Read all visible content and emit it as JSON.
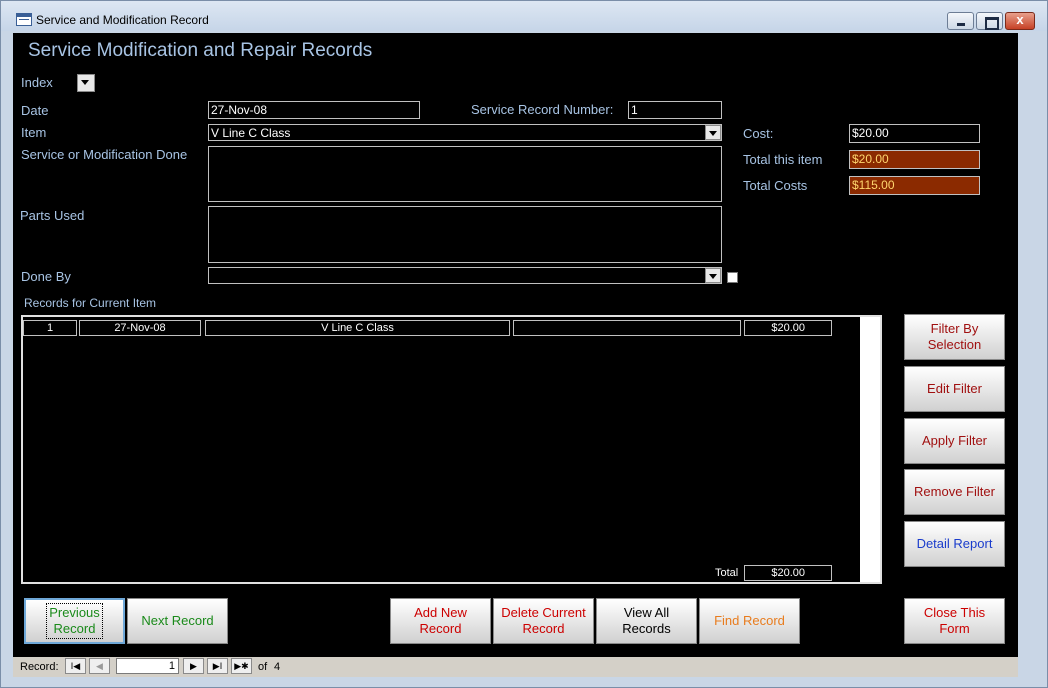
{
  "window": {
    "title": "Service and Modification Record",
    "close_glyph": "x"
  },
  "form": {
    "heading": "Service Modification and Repair Records",
    "index_label": "Index",
    "date_label": "Date",
    "date_value": "27-Nov-08",
    "service_record_number_label": "Service Record Number:",
    "service_record_number_value": "1",
    "item_label": "Item",
    "item_value": "V Line C Class",
    "service_label": "Service or Modification Done",
    "service_value": "",
    "parts_label": "Parts Used",
    "parts_value": "",
    "done_by_label": "Done By",
    "done_by_value": "",
    "cost_label": "Cost:",
    "cost_value": "$20.00",
    "total_item_label": "Total this item",
    "total_item_value": "$20.00",
    "total_costs_label": "Total Costs",
    "total_costs_value": "$115.00",
    "records_label": "Records for Current Item"
  },
  "records": {
    "rows": [
      {
        "number": "1",
        "date": "27-Nov-08",
        "item": "V Line C Class",
        "details": "",
        "cost": "$20.00"
      }
    ],
    "total_label": "Total",
    "total_value": "$20.00"
  },
  "side_buttons": {
    "filter_by_selection": "Filter By\nSelection",
    "edit_filter": "Edit Filter",
    "apply_filter": "Apply Filter",
    "remove_filter": "Remove Filter",
    "detail_report": "Detail Report"
  },
  "bottom_buttons": {
    "previous": "Previous\nRecord",
    "next": "Next Record",
    "add": "Add New\nRecord",
    "delete": "Delete Current\nRecord",
    "view_all": "View All\nRecords",
    "find": "Find Record",
    "close": "Close This\nForm"
  },
  "navigation": {
    "record_label": "Record:",
    "current": "1",
    "of_label": "of",
    "total": "4",
    "first_glyph": "I◀",
    "prev_glyph": "◀",
    "next_glyph": "▶",
    "last_glyph": "▶I",
    "new_glyph": "▶✱"
  },
  "colors": {
    "form_background": "#000000",
    "label": "#a8c4e4",
    "total_field": "#8b2a00",
    "total_text": "#ffd66e",
    "btn_green": "#1a8a1a",
    "btn_red": "#cc0000",
    "btn_dark_red": "#a01010",
    "btn_orange": "#e87c1e",
    "btn_blue": "#1a3ccc",
    "btn_black": "#000000"
  }
}
